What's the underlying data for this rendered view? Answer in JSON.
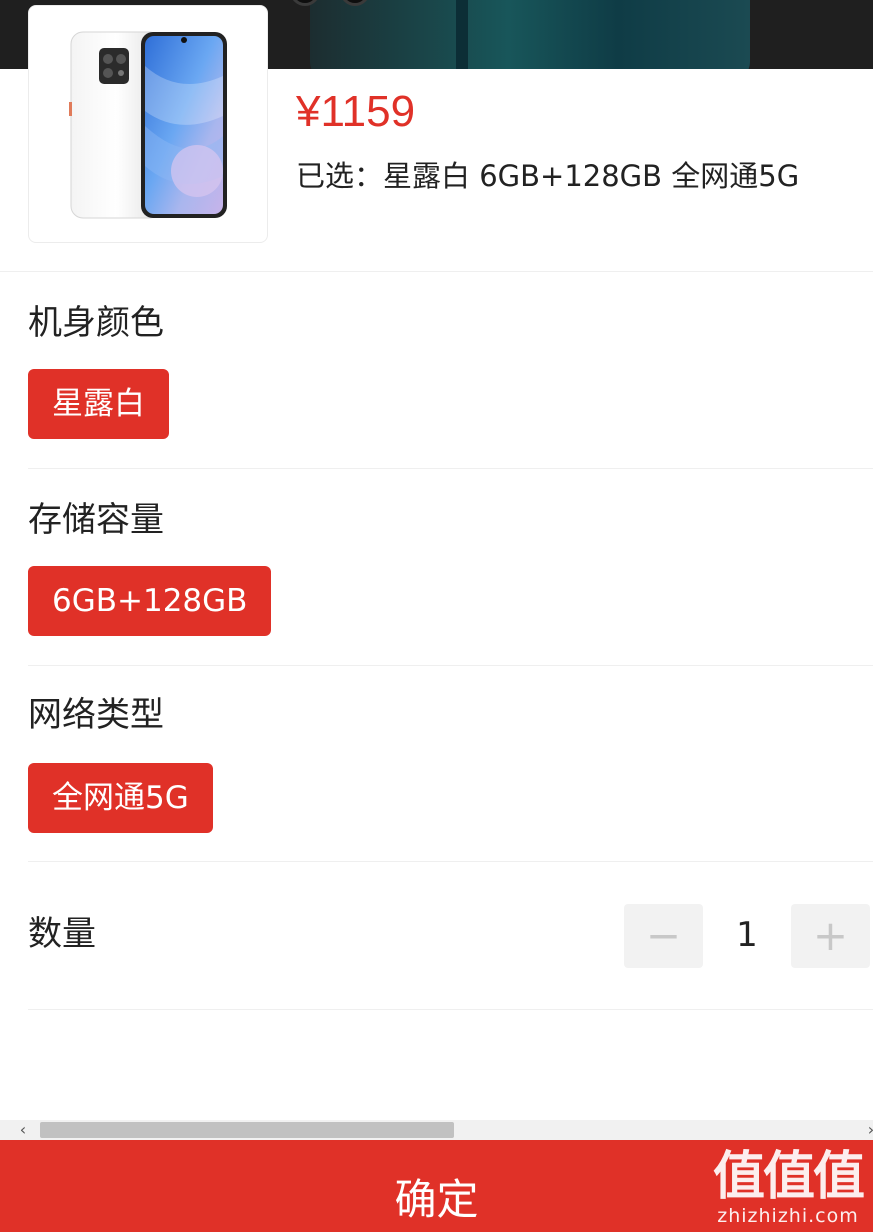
{
  "product": {
    "price": "¥1159",
    "selected_text": "已选：星露白 6GB+128GB 全网通5G"
  },
  "specs": [
    {
      "title": "机身颜色",
      "option": "星露白"
    },
    {
      "title": "存储容量",
      "option": "6GB+128GB"
    },
    {
      "title": "网络类型",
      "option": "全网通5G"
    }
  ],
  "quantity": {
    "label": "数量",
    "value": "1",
    "minus": "−",
    "plus": "+"
  },
  "confirm_label": "确定",
  "watermark": {
    "logo": "值值值",
    "domain": "zhizhizhi.com"
  },
  "colors": {
    "accent": "#e03128",
    "stepper_bg": "#f2f2f2"
  }
}
